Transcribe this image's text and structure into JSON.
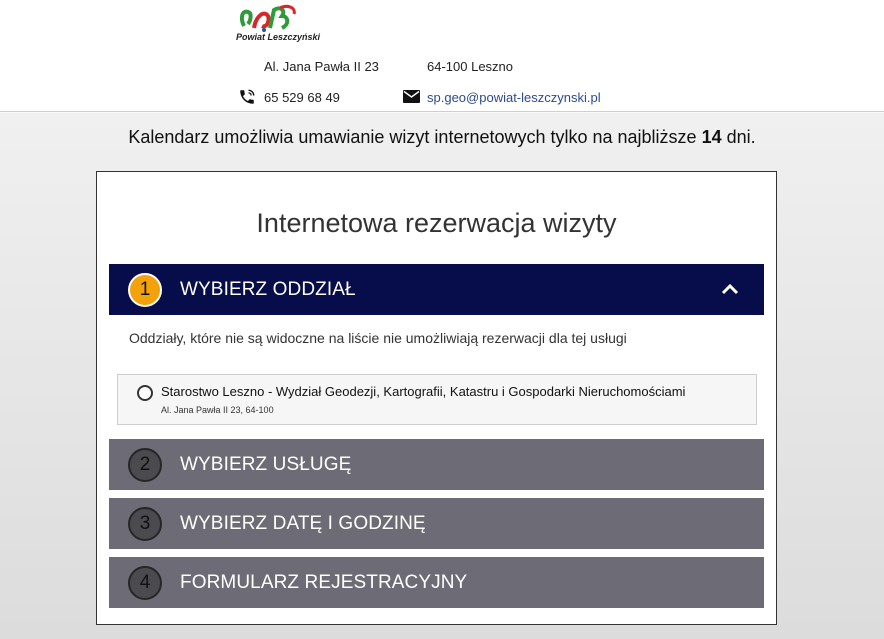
{
  "header": {
    "logo_text": "Powiat Leszczyński",
    "street": "Al. Jana Pawła II 23",
    "city": "64-100 Leszno",
    "phone": "65 529 68 49",
    "email": "sp.geo@powiat-leszczynski.pl"
  },
  "notice": {
    "prefix": "Kalendarz umożliwia umawianie wizyt internetowych tylko na najbliższe",
    "days": "14",
    "suffix": "dni."
  },
  "card": {
    "title": "Internetowa rezerwacja wizyty",
    "steps": [
      {
        "num": "1",
        "label": "WYBIERZ ODDZIAŁ"
      },
      {
        "num": "2",
        "label": "WYBIERZ USŁUGĘ"
      },
      {
        "num": "3",
        "label": "WYBIERZ DATĘ I GODZINĘ"
      },
      {
        "num": "4",
        "label": "FORMULARZ REJESTRACYJNY"
      }
    ],
    "hint": "Oddziały, które nie są widoczne na liście nie umożliwiają rezerwacji dla tej usługi",
    "option": {
      "name": "Starostwo Leszno - Wydział Geodezji, Kartografii, Katastru i Gospodarki Nieruchomościami",
      "address": "Al. Jana Pawła II 23, 64-100"
    }
  },
  "colors": {
    "active_step": "#070c4a",
    "inactive_step": "#6d6c76",
    "active_badge": "#f4a20b"
  },
  "icons": [
    "logo-icon",
    "phone-icon",
    "mail-icon",
    "chevron-up-icon",
    "radio-icon"
  ]
}
